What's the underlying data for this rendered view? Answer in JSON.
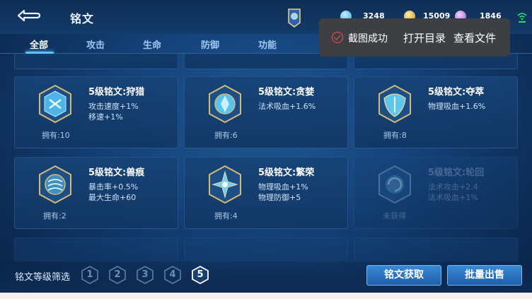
{
  "header": {
    "title": "铭文",
    "back_icon": "back-arrow-icon",
    "currency": [
      {
        "icon": "diamond-icon",
        "value": "3248"
      },
      {
        "icon": "gold-coin-icon",
        "value": "15009"
      },
      {
        "icon": "crystal-icon",
        "value": "1846"
      }
    ]
  },
  "tabs": [
    {
      "label": "全部",
      "active": true
    },
    {
      "label": "攻击",
      "active": false
    },
    {
      "label": "生命",
      "active": false
    },
    {
      "label": "防御",
      "active": false
    },
    {
      "label": "功能",
      "active": false
    }
  ],
  "toast": {
    "message": "截图成功",
    "open_dir": "打开目录",
    "view_file": "查看文件",
    "accent": "#ff4d4d"
  },
  "cards": [
    {
      "name": "5级铭文:狩猎",
      "stats": [
        "攻击速度+1%",
        "移速+1%"
      ],
      "owned": "拥有:10",
      "obtained": true
    },
    {
      "name": "5级铭文:贪婪",
      "stats": [
        "法术吸血+1.6%"
      ],
      "owned": "拥有:6",
      "obtained": true
    },
    {
      "name": "5级铭文:夺萃",
      "stats": [
        "物理吸血+1.6%"
      ],
      "owned": "拥有:8",
      "obtained": true
    },
    {
      "name": "5级铭文:兽痕",
      "stats": [
        "暴击率+0.5%",
        "最大生命+60"
      ],
      "owned": "拥有:2",
      "obtained": true
    },
    {
      "name": "5级铭文:繁荣",
      "stats": [
        "物理吸血+1%",
        "物理防御+5"
      ],
      "owned": "拥有:4",
      "obtained": true
    },
    {
      "name": "5级铭文:轮回",
      "stats": [
        "法术攻击+2.4",
        "法术吸血+1%"
      ],
      "owned": "未获得",
      "obtained": false
    }
  ],
  "filter": {
    "label": "铭文等级筛选",
    "levels": [
      "1",
      "2",
      "3",
      "4",
      "5"
    ],
    "selected": "5"
  },
  "buttons": {
    "obtain": "铭文获取",
    "bulk_sell": "批量出售"
  }
}
